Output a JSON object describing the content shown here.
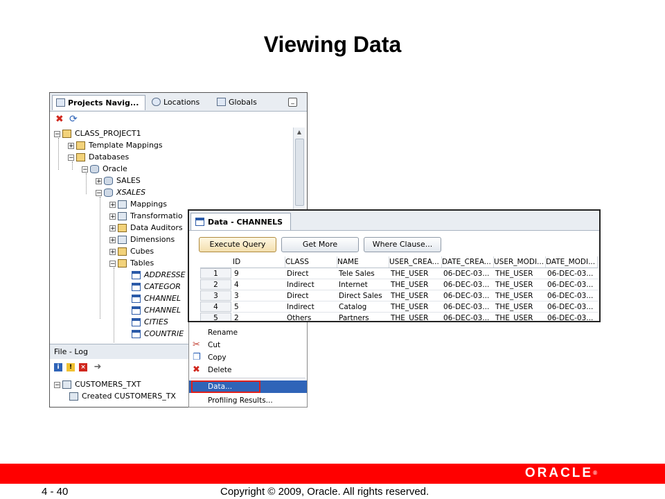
{
  "slide": {
    "title": "Viewing Data",
    "page_number": "4 - 40",
    "copyright": "Copyright © 2009, Oracle. All rights reserved.",
    "logo": "ORACLE"
  },
  "navigator": {
    "tabs": [
      {
        "label": "Projects Navig...",
        "icon": "projects-icon",
        "active": true
      },
      {
        "label": "Locations",
        "icon": "locations-icon",
        "active": false
      },
      {
        "label": "Globals",
        "icon": "globals-icon",
        "active": false
      }
    ],
    "toolbar": [
      "delete-icon",
      "refresh-icon"
    ],
    "tree": [
      {
        "label": "CLASS_PROJECT1",
        "expander": "−",
        "icon": "folder",
        "italic": false
      },
      {
        "label": "Template Mappings",
        "expander": "+",
        "icon": "folder",
        "italic": false
      },
      {
        "label": "Databases",
        "expander": "−",
        "icon": "folder",
        "italic": false
      },
      {
        "label": "Oracle",
        "expander": "−",
        "icon": "db",
        "italic": false
      },
      {
        "label": "SALES",
        "expander": "+",
        "icon": "db",
        "italic": false
      },
      {
        "label": "XSALES",
        "expander": "−",
        "icon": "db",
        "italic": true
      },
      {
        "label": "Mappings",
        "expander": "+",
        "icon": "map",
        "italic": false
      },
      {
        "label": "Transformatio",
        "expander": "+",
        "icon": "map",
        "italic": false
      },
      {
        "label": "Data Auditors",
        "expander": "+",
        "icon": "folder",
        "italic": false
      },
      {
        "label": "Dimensions",
        "expander": "+",
        "icon": "map",
        "italic": false
      },
      {
        "label": "Cubes",
        "expander": "+",
        "icon": "folder",
        "italic": false
      },
      {
        "label": "Tables",
        "expander": "−",
        "icon": "folder",
        "italic": false
      },
      {
        "label": "ADDRESSE",
        "expander": "",
        "icon": "table",
        "italic": true
      },
      {
        "label": "CATEGOR",
        "expander": "",
        "icon": "table",
        "italic": true
      },
      {
        "label": "CHANNEL",
        "expander": "",
        "icon": "table",
        "italic": true
      },
      {
        "label": "CHANNEL",
        "expander": "",
        "icon": "table",
        "italic": true
      },
      {
        "label": "CITIES",
        "expander": "",
        "icon": "table",
        "italic": true
      },
      {
        "label": "COUNTRIE",
        "expander": "",
        "icon": "table",
        "italic": true
      }
    ]
  },
  "log": {
    "title": "File  - Log",
    "toolbar": [
      "info-icon",
      "warning-icon",
      "error-icon",
      "arrow-right-icon"
    ],
    "rows": [
      {
        "label": "CUSTOMERS_TXT",
        "expander": "−"
      },
      {
        "label": "Created CUSTOMERS_TX",
        "expander": ""
      }
    ]
  },
  "context_menu": {
    "items": [
      {
        "label": "Rename",
        "icon": "",
        "selected": false
      },
      {
        "label": "Cut",
        "icon": "scissors-icon",
        "selected": false
      },
      {
        "label": "Copy",
        "icon": "copy-icon",
        "selected": false
      },
      {
        "label": "Delete",
        "icon": "delete-icon",
        "selected": false
      },
      {
        "label": "Data...",
        "icon": "",
        "selected": true
      },
      {
        "label": "Profiling Results...",
        "icon": "",
        "selected": false
      }
    ]
  },
  "data_window": {
    "tab_label": "Data - CHANNELS",
    "buttons": [
      "Execute Query",
      "Get More",
      "Where Clause..."
    ],
    "columns": [
      "ID",
      "CLASS",
      "NAME",
      "USER_CREA...",
      "DATE_CREA...",
      "USER_MODI...",
      "DATE_MODI..."
    ],
    "rows": [
      {
        "num": "1",
        "cells": [
          "9",
          "Direct",
          "Tele Sales",
          "THE_USER",
          "06-DEC-03...",
          "THE_USER",
          "06-DEC-03..."
        ]
      },
      {
        "num": "2",
        "cells": [
          "4",
          "Indirect",
          "Internet",
          "THE_USER",
          "06-DEC-03...",
          "THE_USER",
          "06-DEC-03..."
        ]
      },
      {
        "num": "3",
        "cells": [
          "3",
          "Direct",
          "Direct Sales",
          "THE_USER",
          "06-DEC-03...",
          "THE_USER",
          "06-DEC-03..."
        ]
      },
      {
        "num": "4",
        "cells": [
          "5",
          "Indirect",
          "Catalog",
          "THE_USER",
          "06-DEC-03...",
          "THE_USER",
          "06-DEC-03..."
        ]
      },
      {
        "num": "5",
        "cells": [
          "2",
          "Others",
          "Partners",
          "THE_USER",
          "06-DEC-03...",
          "THE_USER",
          "06-DEC-03..."
        ]
      }
    ]
  },
  "colors": {
    "footer_band": "#ff0000",
    "menu_selection": "#2f64b8",
    "highlight_box": "#e0201a"
  }
}
